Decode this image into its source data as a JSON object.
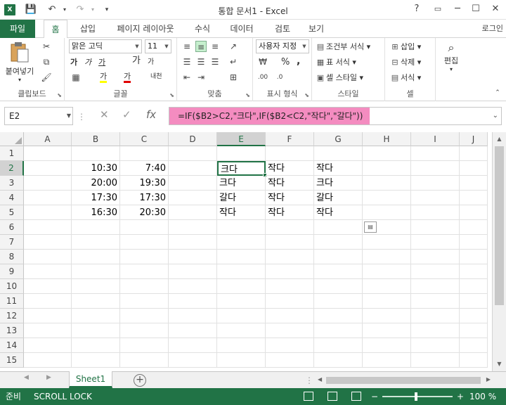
{
  "app": {
    "title": "통합 문서1 - Excel",
    "logo": "X",
    "login": "로그인"
  },
  "qat": {
    "save_icon": "💾",
    "undo_icon": "↶",
    "redo_icon": "↷",
    "customize_icon": "▾"
  },
  "window": {
    "help": "?",
    "ribbon_display": "▭",
    "minimize": "─",
    "maximize": "☐",
    "close": "✕"
  },
  "tabs": {
    "file": "파일",
    "items": [
      "홈",
      "삽입",
      "페이지 레이아웃",
      "수식",
      "데이터",
      "검토",
      "보기"
    ],
    "active": "홈"
  },
  "ribbon": {
    "clipboard": {
      "label": "클립보드",
      "paste": "붙여넣기"
    },
    "font": {
      "label": "글꼴",
      "name": "맑은 고딕",
      "size": "11",
      "grow": "가",
      "shrink": "가",
      "bold": "가",
      "italic": "가",
      "underline": "가",
      "highlight": "가",
      "fontcolor": "가",
      "phonetic": "내천"
    },
    "alignment": {
      "label": "맞춤"
    },
    "number": {
      "label": "표시 형식",
      "format": "사용자 지정",
      "percent": "%",
      "comma": ","
    },
    "styles": {
      "label": "스타일",
      "conditional": "조건부 서식",
      "table": "표 서식",
      "cell": "셀 스타일"
    },
    "cells": {
      "label": "셀",
      "insert": "삽입",
      "delete": "삭제",
      "format": "서식"
    },
    "editing": {
      "label": "편집"
    }
  },
  "formula_bar": {
    "name_box": "E2",
    "formula": "=IF($B2>C2,\"크다\",IF($B2<C2,\"작다\",\"갈다\"))"
  },
  "sheet": {
    "columns": [
      "A",
      "B",
      "C",
      "D",
      "E",
      "F",
      "G",
      "H",
      "I",
      "J"
    ],
    "rows": [
      "1",
      "2",
      "3",
      "4",
      "5",
      "6",
      "7",
      "8",
      "9",
      "10",
      "11",
      "12",
      "13",
      "14",
      "15"
    ],
    "selected_column": "E",
    "selected_row": "2",
    "cells": {
      "B2": "10:30",
      "C2": "7:40",
      "E2": "크다",
      "F2": "작다",
      "G2": "작다",
      "B3": "20:00",
      "C3": "19:30",
      "E3": "크다",
      "F3": "작다",
      "G3": "크다",
      "B4": "17:30",
      "C4": "17:30",
      "E4": "갈다",
      "F4": "작다",
      "G4": "갈다",
      "B5": "16:30",
      "C5": "20:30",
      "E5": "작다",
      "F5": "작다",
      "G5": "작다"
    },
    "tab": "Sheet1"
  },
  "status": {
    "ready": "준비",
    "scroll_lock": "SCROLL LOCK",
    "zoom": "100 %",
    "zoom_minus": "−",
    "zoom_plus": "+"
  },
  "colors": {
    "accent": "#217346",
    "formula_highlight": "#f48cc0"
  }
}
